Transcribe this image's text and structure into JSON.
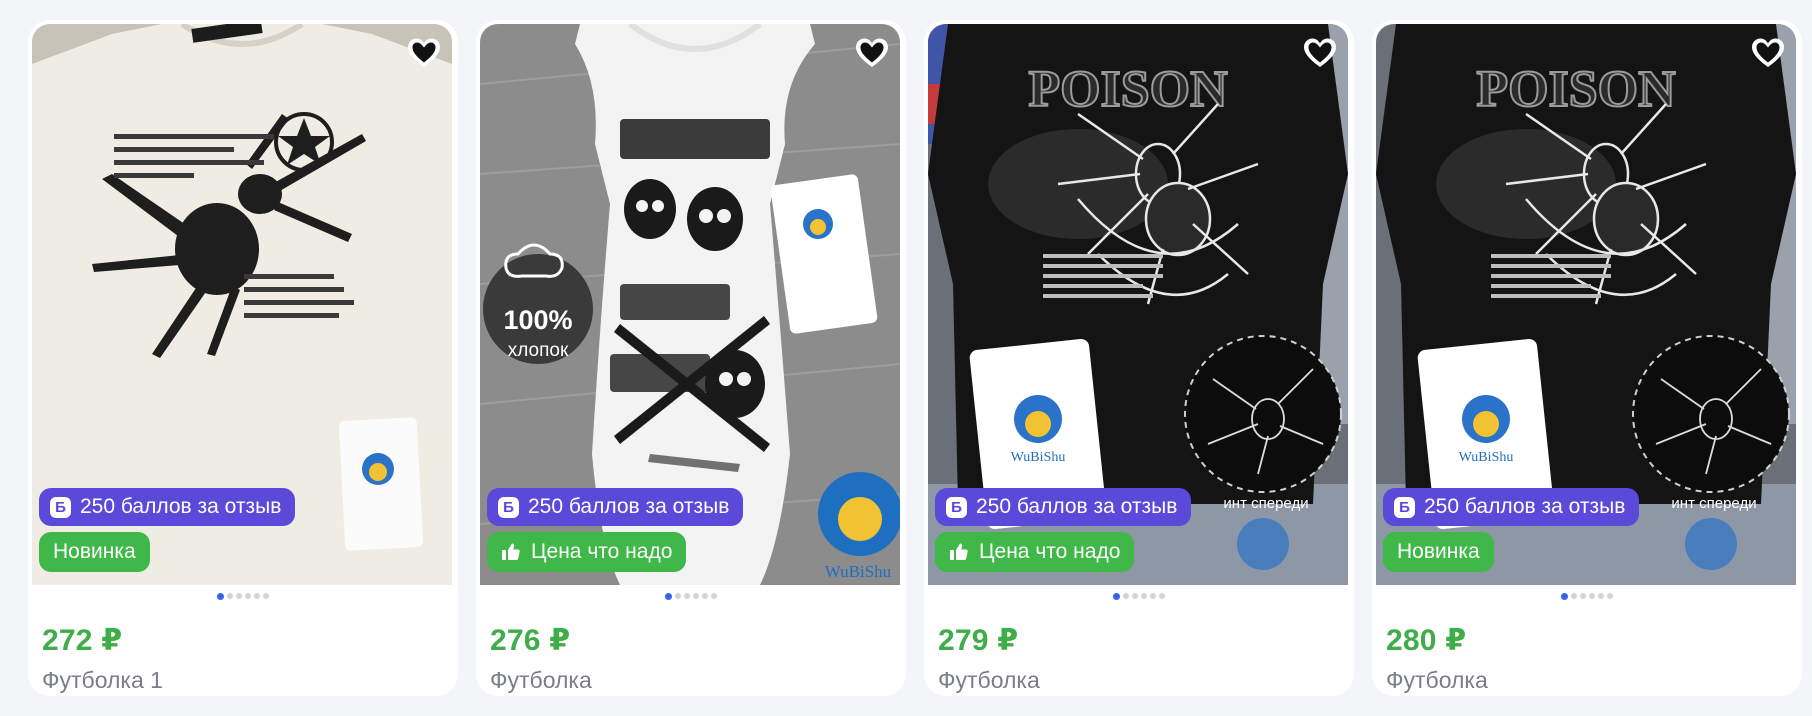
{
  "products": [
    {
      "price": "272 ₽",
      "title": "Футболка 1",
      "points_badge": "250 баллов за отзыв",
      "points_icon": "Б",
      "tag_label": "Новинка",
      "tag_icon": "",
      "photo_text": [],
      "active_dot": 0,
      "dot_count": 6
    },
    {
      "price": "276 ₽",
      "title": "Футболка",
      "points_badge": "250 баллов за отзыв",
      "points_icon": "Б",
      "tag_label": "Цена что надо",
      "tag_icon": "thumbs-up-icon",
      "photo_text": [
        "100%",
        "хлопок",
        "WuBiShu"
      ],
      "active_dot": 0,
      "dot_count": 6
    },
    {
      "price": "279 ₽",
      "title": "Футболка",
      "points_badge": "250 баллов за отзыв",
      "points_icon": "Б",
      "tag_label": "Цена что надо",
      "tag_icon": "thumbs-up-icon",
      "photo_text": [
        "POISON",
        "WuBiShu",
        "инт спереди"
      ],
      "active_dot": 0,
      "dot_count": 6
    },
    {
      "price": "280 ₽",
      "title": "Футболка",
      "points_badge": "250 баллов за отзыв",
      "points_icon": "Б",
      "tag_label": "Новинка",
      "tag_icon": "",
      "photo_text": [
        "POISON",
        "WuBiShu",
        "инт спереди"
      ],
      "active_dot": 0,
      "dot_count": 6
    }
  ],
  "colors": {
    "page_background": "#f4f5f9",
    "price": "#3fae49",
    "points_badge": "#5b49d9",
    "tag_badge": "#3fb849",
    "active_dot": "#3463e8"
  }
}
